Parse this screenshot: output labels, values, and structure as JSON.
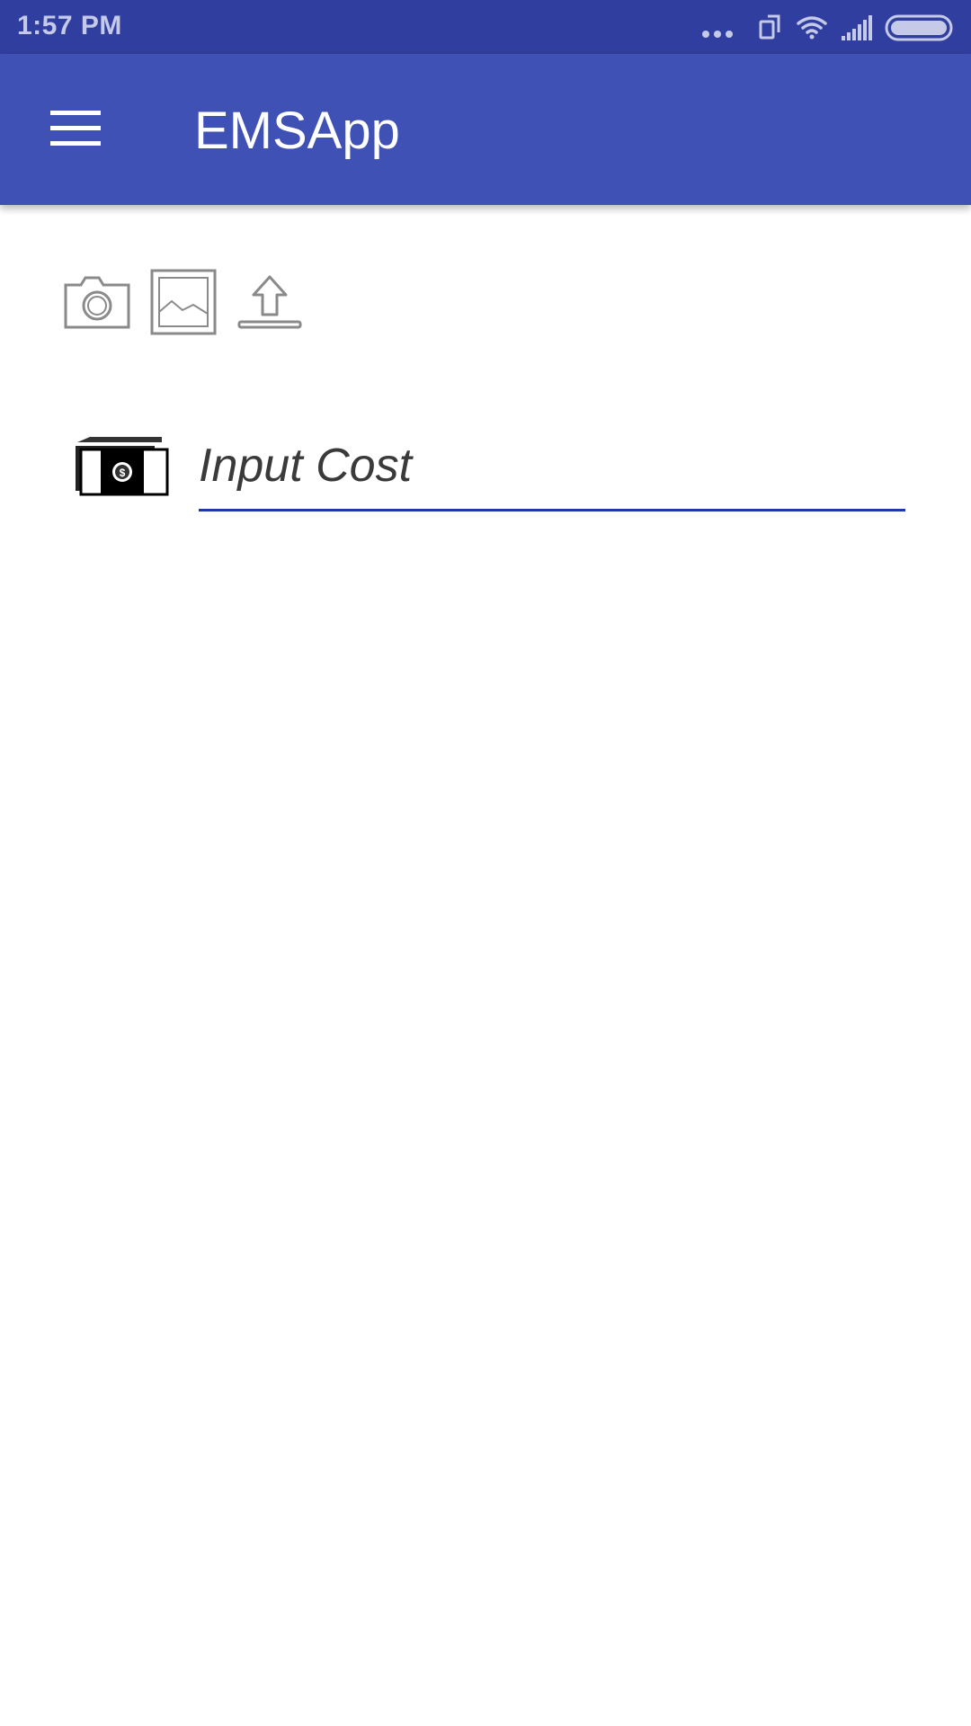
{
  "status_bar": {
    "time": "1:57 PM",
    "icons": [
      "more-dots-icon",
      "screen-rotate-icon",
      "wifi-icon",
      "signal-icon",
      "battery-icon"
    ]
  },
  "app_bar": {
    "title": "EMSApp",
    "menu_icon": "hamburger-menu-icon",
    "background": "#3f51b5",
    "status_background": "#303f9f"
  },
  "toolbar": {
    "buttons": [
      "camera-icon",
      "gallery-icon",
      "upload-icon"
    ]
  },
  "cost_field": {
    "icon": "money-icon",
    "placeholder": "Input Cost",
    "value": "",
    "underline_color": "#1c39a8"
  }
}
